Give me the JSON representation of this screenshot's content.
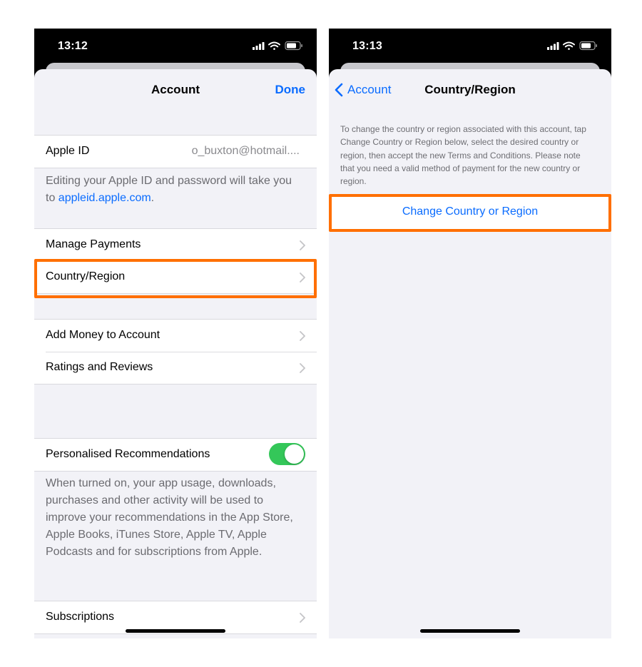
{
  "left_screen": {
    "status": {
      "time": "13:12"
    },
    "nav": {
      "title": "Account",
      "done_label": "Done"
    },
    "apple_id": {
      "label": "Apple ID",
      "value": "o_buxton@hotmail....",
      "note_prefix": "Editing your Apple ID and password will take you to ",
      "note_link": "appleid.apple.com",
      "note_suffix": "."
    },
    "group2": [
      {
        "label": "Manage Payments"
      },
      {
        "label": "Country/Region"
      }
    ],
    "group3": [
      {
        "label": "Add Money to Account"
      },
      {
        "label": "Ratings and Reviews"
      }
    ],
    "recommendations": {
      "label": "Personalised Recommendations",
      "enabled": true,
      "description": "When turned on, your app usage, downloads, purchases and other activity will be used to improve your recommendations in the App Store, Apple Books, iTunes Store, Apple TV, Apple Podcasts and for subscriptions from Apple."
    },
    "subscriptions": {
      "label": "Subscriptions"
    }
  },
  "right_screen": {
    "status": {
      "time": "13:13"
    },
    "nav": {
      "back_label": "Account",
      "title": "Country/Region"
    },
    "info": "To change the country or region associated with this account, tap Change Country or Region below, select the desired country or region, then accept the new Terms and Conditions. Please note that you need a valid method of payment for the new country or region.",
    "action_label": "Change Country or Region"
  },
  "colors": {
    "accent": "#0a6cff",
    "highlight": "#ff6f00",
    "toggle_on": "#34c759",
    "background": "#f2f2f7"
  },
  "icons": [
    "signal-icon",
    "wifi-icon",
    "battery-icon",
    "chevron-right-icon",
    "chevron-left-icon"
  ]
}
